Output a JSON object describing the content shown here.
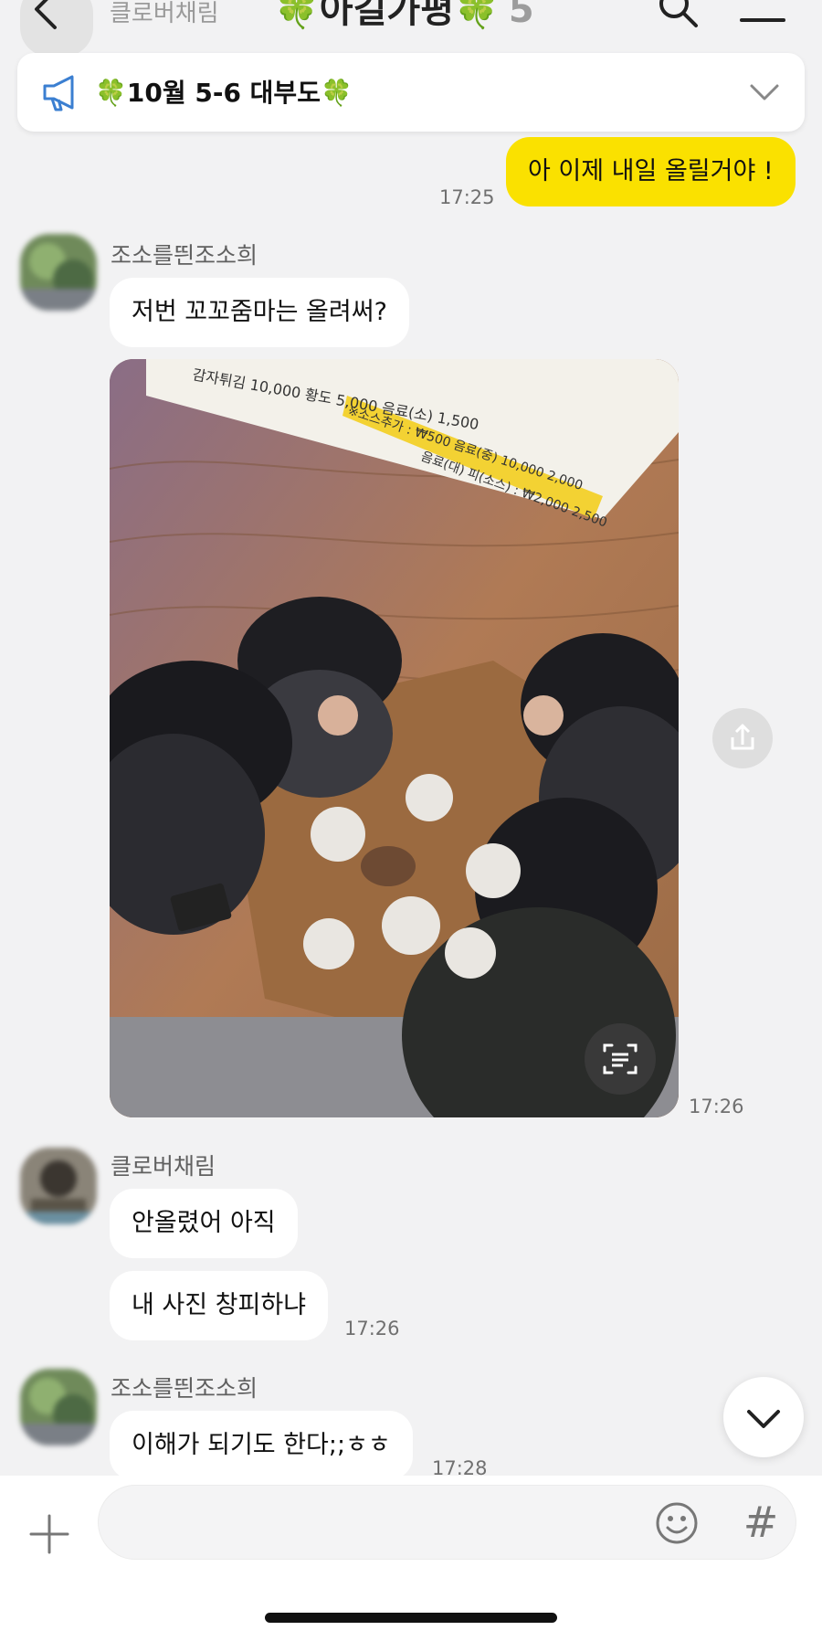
{
  "header": {
    "ghost_sender": "클로버채림",
    "title": "🍀아길가평🍀",
    "member_count": "5"
  },
  "notice": {
    "text": "🍀10월 5-6 대부도🍀"
  },
  "messages": [
    {
      "from_me": true,
      "text": "아 이제 내일 올릴거야 !",
      "time": "17:25"
    },
    {
      "sender": "조소를띈조소희",
      "text": "저번 꼬꼬줌마는 올려써?"
    },
    {
      "type": "photo",
      "time": "17:26"
    },
    {
      "sender": "클로버채림",
      "texts": [
        "안올렸어 아직",
        "내 사진 창피하냐"
      ],
      "time": "17:26"
    },
    {
      "sender": "조소를띈조소희",
      "text": "이해가 되기도 한다;;ㅎㅎ",
      "time": "17:28"
    }
  ],
  "photo_menu": {
    "row1": "감자튀김  10,000  황도  5,000  음료(소) 1,500",
    "row2": "※소스추가 : ₩500   음료(중) 10,000  2,000",
    "row3": "음료(대)  피(소스) : ₩2,000   2,500"
  },
  "icons": {
    "back": "back-chevron-icon",
    "search": "search-icon",
    "menu": "hamburger-menu-icon",
    "notice": "megaphone-icon",
    "expand": "chevron-down-icon",
    "share": "share-icon",
    "ocr": "text-scan-icon",
    "scroll_down": "chevron-down-icon",
    "plus": "plus-icon",
    "emoji": "emoji-icon",
    "hash": "hash-icon"
  },
  "input": {
    "hash_label": "#"
  },
  "colors": {
    "background": "#f2f2f3",
    "my_bubble": "#fae100",
    "other_bubble": "#ffffff"
  }
}
